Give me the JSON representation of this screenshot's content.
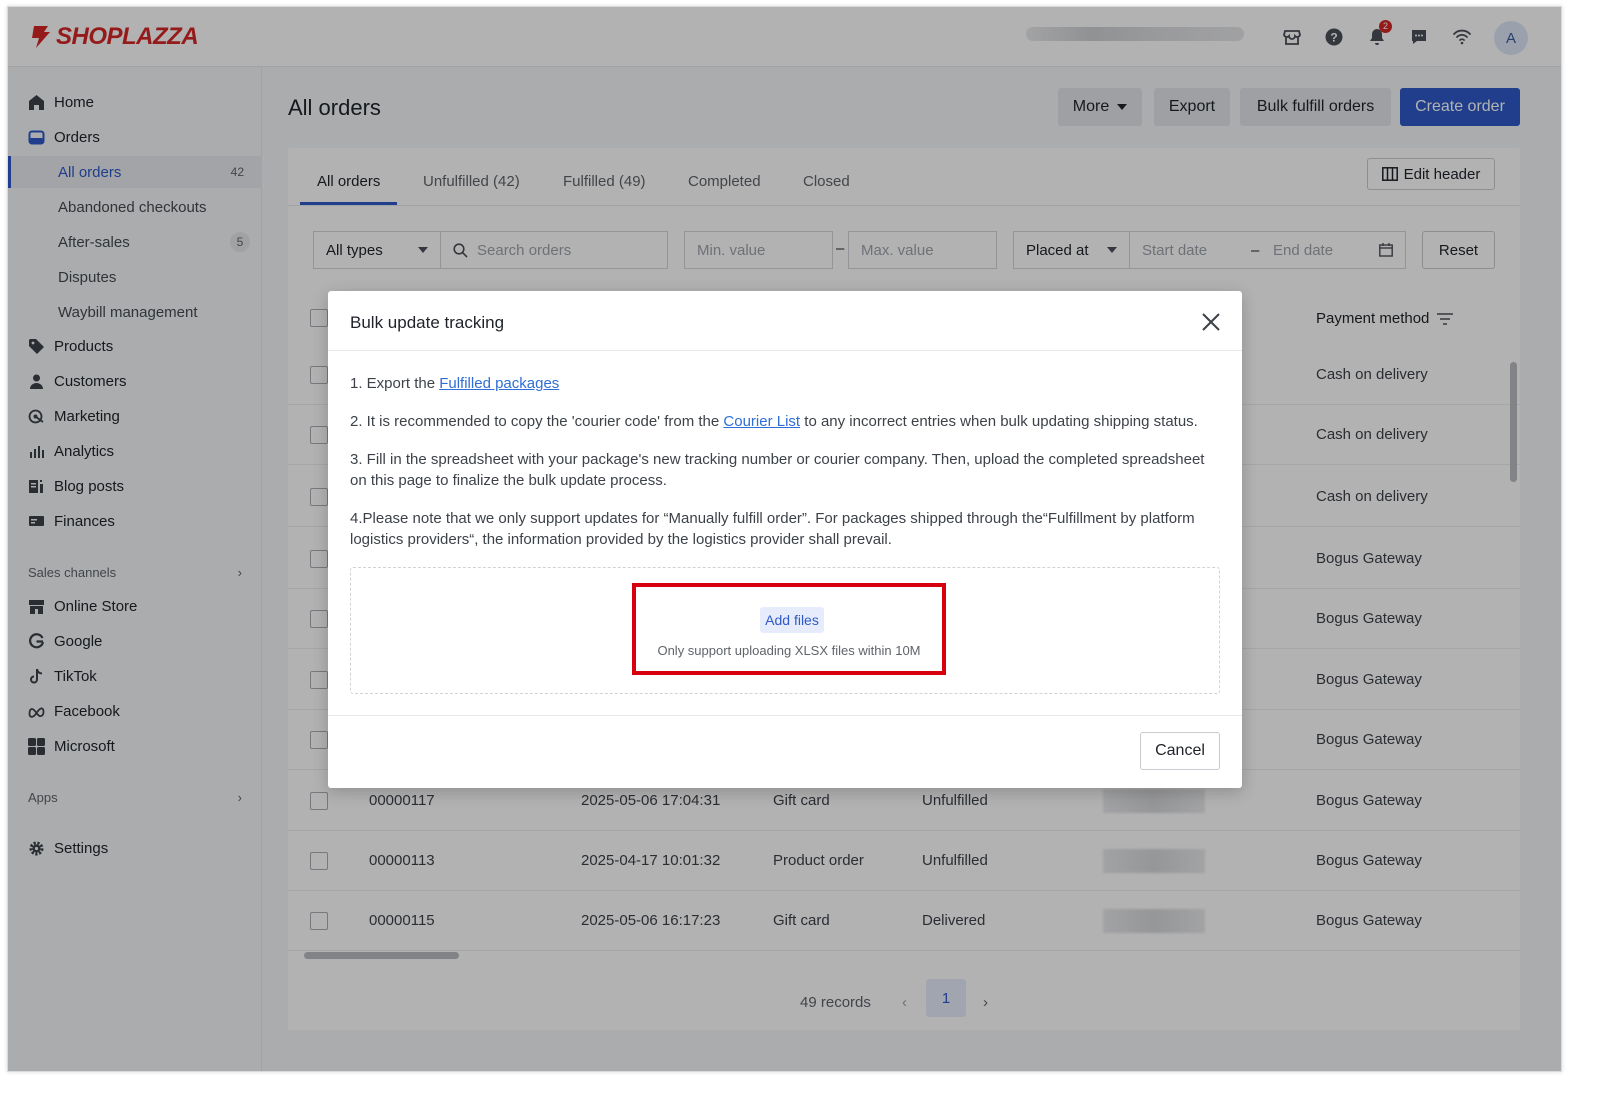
{
  "brand": {
    "name": "SHOPLAZZA",
    "color": "#d62828"
  },
  "topbar": {
    "notification_count": "2",
    "avatar_letter": "A"
  },
  "sidebar": {
    "home": "Home",
    "orders": "Orders",
    "order_subitems": [
      {
        "label": "All orders",
        "count": "42"
      },
      {
        "label": "Abandoned checkouts"
      },
      {
        "label": "After-sales",
        "count": "5"
      },
      {
        "label": "Disputes"
      },
      {
        "label": "Waybill management"
      }
    ],
    "items": [
      "Products",
      "Customers",
      "Marketing",
      "Analytics",
      "Blog posts",
      "Finances"
    ],
    "sales_channels_header": "Sales channels",
    "channels": [
      "Online Store",
      "Google",
      "TikTok",
      "Facebook",
      "Microsoft"
    ],
    "apps_header": "Apps",
    "settings": "Settings"
  },
  "page": {
    "title": "All orders",
    "buttons": {
      "more": "More",
      "export": "Export",
      "bulk_fulfill": "Bulk fulfill orders",
      "create": "Create order"
    },
    "tabs": [
      "All orders",
      "Unfulfilled (42)",
      "Fulfilled (49)",
      "Completed",
      "Closed"
    ],
    "edit_header": "Edit header",
    "filters": {
      "type": "All types",
      "search_placeholder": "Search orders",
      "min_placeholder": "Min. value",
      "dash": "–",
      "max_placeholder": "Max. value",
      "date_type": "Placed at",
      "start_placeholder": "Start date",
      "end_placeholder": "End date",
      "reset": "Reset"
    },
    "payment_header": "Payment method",
    "rows": [
      {
        "payment": "Cash on delivery"
      },
      {
        "payment": "Cash on delivery"
      },
      {
        "payment": "Cash on delivery"
      },
      {
        "payment": "Bogus Gateway"
      },
      {
        "payment": "Bogus Gateway"
      },
      {
        "payment": "Bogus Gateway"
      },
      {
        "payment": "Bogus Gateway"
      },
      {
        "id": "00000117",
        "date": "2025-05-06 17:04:31",
        "type": "Gift card",
        "status": "Unfulfilled",
        "payment": "Bogus Gateway"
      },
      {
        "id": "00000113",
        "date": "2025-04-17 10:01:32",
        "type": "Product order",
        "status": "Unfulfilled",
        "payment": "Bogus Gateway"
      },
      {
        "id": "00000115",
        "date": "2025-05-06 16:17:23",
        "type": "Gift card",
        "status": "Delivered",
        "payment": "Bogus Gateway"
      }
    ],
    "records": "49 records",
    "current_page": "1"
  },
  "modal": {
    "title": "Bulk update tracking",
    "step1_prefix": "1. Export the ",
    "step1_link": "Fulfilled packages",
    "step2_prefix": "2. It is recommended to copy the 'courier code' from the ",
    "step2_link": "Courier List",
    "step2_suffix": " to any incorrect entries when bulk updating shipping status.",
    "step3": "3. Fill in the spreadsheet with your package's new tracking number or courier company. Then, upload the completed spreadsheet on this page to finalize the bulk update process.",
    "step4": "4.Please note that we only support updates for “Manually fulfill order”. For packages shipped through the“Fulfillment by platform logistics providers“, the information provided by the logistics provider shall prevail.",
    "add_files": "Add files",
    "hint": "Only support uploading XLSX files within 10M",
    "cancel": "Cancel",
    "highlight_color": "#d7000f"
  }
}
